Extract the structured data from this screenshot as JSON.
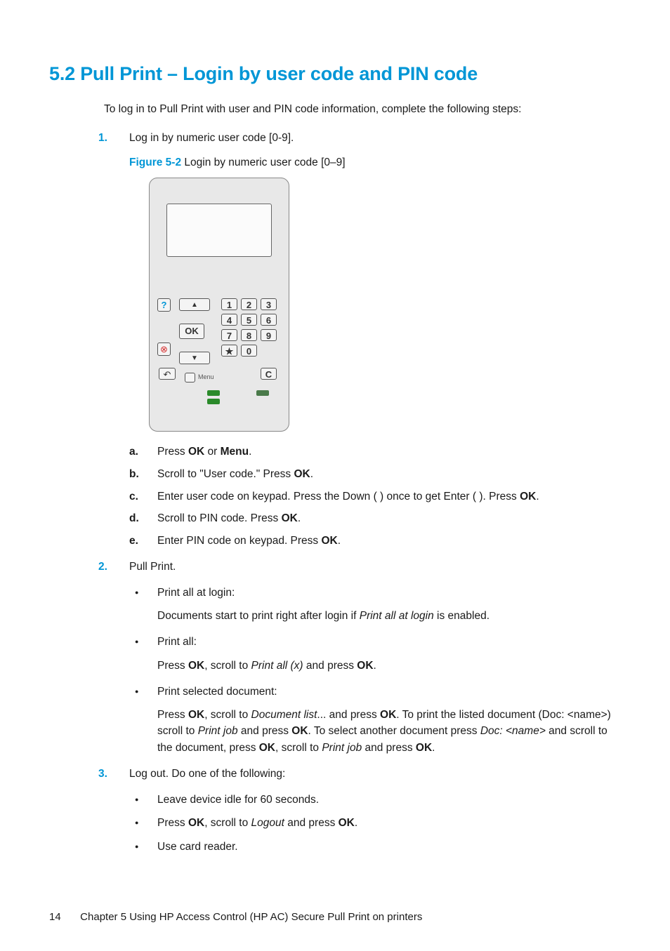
{
  "heading": "5.2 Pull Print – Login by user code and PIN code",
  "intro": "To log in to Pull Print with user and PIN code information, complete the following steps:",
  "step1": {
    "marker": "1.",
    "text": "Log in by numeric user code [0-9].",
    "figLabel": "Figure 5-2",
    "figText": "  Login by numeric user code [0–9]"
  },
  "keypad": {
    "help": "?",
    "cancel": "⊗",
    "back": "↶",
    "up": "▲",
    "ok": "OK",
    "down": "▼",
    "menu": "Menu",
    "k1": "1",
    "k2": "2",
    "k3": "3",
    "k4": "4",
    "k5": "5",
    "k6": "6",
    "k7": "7",
    "k8": "8",
    "k9": "9",
    "k0": "0",
    "kstar": "★",
    "kc": "C"
  },
  "alpha": {
    "a": {
      "m": "a.",
      "pre": "Press ",
      "b1": "OK",
      "mid": " or ",
      "b2": "Menu",
      "post": "."
    },
    "b": {
      "m": "b.",
      "pre": "Scroll to \"User code.\" Press ",
      "b1": "OK",
      "post": "."
    },
    "c": {
      "m": "c.",
      "pre": "Enter user code on keypad. Press the Down (    ) once to get Enter (       ). Press ",
      "b1": "OK",
      "post": "."
    },
    "d": {
      "m": "d.",
      "pre": "Scroll to PIN code. Press ",
      "b1": "OK",
      "post": "."
    },
    "e": {
      "m": "e.",
      "pre": "Enter PIN code on keypad. Press ",
      "b1": "OK",
      "post": "."
    }
  },
  "step2": {
    "marker": "2.",
    "text": "Pull Print.",
    "b1": {
      "title": "Print all at login:",
      "para_pre": "Documents start to print right after login if ",
      "para_i": "Print all at login",
      "para_post": " is enabled."
    },
    "b2": {
      "title": "Print all:",
      "p_pre": "Press ",
      "p_b1": "OK",
      "p_mid1": ", scroll to ",
      "p_i1": "Print all (x)",
      "p_mid2": " and press ",
      "p_b2": "OK",
      "p_post": "."
    },
    "b3": {
      "title": "Print selected document:",
      "p_pre": "Press ",
      "p_b1": "OK",
      "p_mid1": ", scroll to ",
      "p_i1": "Document list",
      "p_mid2": "... and press ",
      "p_b2": "OK",
      "p_mid3": ". To print the listed document (Doc: <name>) scroll to ",
      "p_i2": "Print job",
      "p_mid4": " and press ",
      "p_b3": "OK",
      "p_mid5": ". To select another document press ",
      "p_i3": "Doc: <name>",
      "p_mid6": " and scroll to the document, press ",
      "p_b4": "OK",
      "p_mid7": ", scroll to ",
      "p_i4": "Print job",
      "p_mid8": " and press ",
      "p_b5": "OK",
      "p_post": "."
    }
  },
  "step3": {
    "marker": "3.",
    "text": "Log out. Do one of the following:",
    "b1": "Leave device idle for 60 seconds.",
    "b2": {
      "pre": "Press ",
      "b1": "OK",
      "mid1": ", scroll to ",
      "i1": "Logout",
      "mid2": " and press ",
      "b2": "OK",
      "post": "."
    },
    "b3": "Use card reader."
  },
  "footer": {
    "pageNum": "14",
    "chapter": "Chapter 5   Using HP Access Control (HP AC) Secure Pull Print on printers"
  }
}
